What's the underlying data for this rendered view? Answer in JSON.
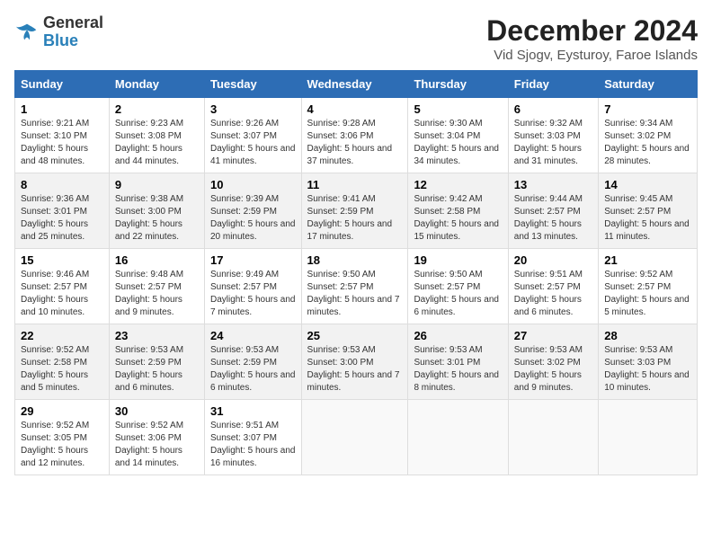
{
  "logo": {
    "general": "General",
    "blue": "Blue"
  },
  "header": {
    "title": "December 2024",
    "subtitle": "Vid Sjogv, Eysturoy, Faroe Islands"
  },
  "days_of_week": [
    "Sunday",
    "Monday",
    "Tuesday",
    "Wednesday",
    "Thursday",
    "Friday",
    "Saturday"
  ],
  "weeks": [
    [
      {
        "day": "1",
        "sunrise": "Sunrise: 9:21 AM",
        "sunset": "Sunset: 3:10 PM",
        "daylight": "Daylight: 5 hours and 48 minutes."
      },
      {
        "day": "2",
        "sunrise": "Sunrise: 9:23 AM",
        "sunset": "Sunset: 3:08 PM",
        "daylight": "Daylight: 5 hours and 44 minutes."
      },
      {
        "day": "3",
        "sunrise": "Sunrise: 9:26 AM",
        "sunset": "Sunset: 3:07 PM",
        "daylight": "Daylight: 5 hours and 41 minutes."
      },
      {
        "day": "4",
        "sunrise": "Sunrise: 9:28 AM",
        "sunset": "Sunset: 3:06 PM",
        "daylight": "Daylight: 5 hours and 37 minutes."
      },
      {
        "day": "5",
        "sunrise": "Sunrise: 9:30 AM",
        "sunset": "Sunset: 3:04 PM",
        "daylight": "Daylight: 5 hours and 34 minutes."
      },
      {
        "day": "6",
        "sunrise": "Sunrise: 9:32 AM",
        "sunset": "Sunset: 3:03 PM",
        "daylight": "Daylight: 5 hours and 31 minutes."
      },
      {
        "day": "7",
        "sunrise": "Sunrise: 9:34 AM",
        "sunset": "Sunset: 3:02 PM",
        "daylight": "Daylight: 5 hours and 28 minutes."
      }
    ],
    [
      {
        "day": "8",
        "sunrise": "Sunrise: 9:36 AM",
        "sunset": "Sunset: 3:01 PM",
        "daylight": "Daylight: 5 hours and 25 minutes."
      },
      {
        "day": "9",
        "sunrise": "Sunrise: 9:38 AM",
        "sunset": "Sunset: 3:00 PM",
        "daylight": "Daylight: 5 hours and 22 minutes."
      },
      {
        "day": "10",
        "sunrise": "Sunrise: 9:39 AM",
        "sunset": "Sunset: 2:59 PM",
        "daylight": "Daylight: 5 hours and 20 minutes."
      },
      {
        "day": "11",
        "sunrise": "Sunrise: 9:41 AM",
        "sunset": "Sunset: 2:59 PM",
        "daylight": "Daylight: 5 hours and 17 minutes."
      },
      {
        "day": "12",
        "sunrise": "Sunrise: 9:42 AM",
        "sunset": "Sunset: 2:58 PM",
        "daylight": "Daylight: 5 hours and 15 minutes."
      },
      {
        "day": "13",
        "sunrise": "Sunrise: 9:44 AM",
        "sunset": "Sunset: 2:57 PM",
        "daylight": "Daylight: 5 hours and 13 minutes."
      },
      {
        "day": "14",
        "sunrise": "Sunrise: 9:45 AM",
        "sunset": "Sunset: 2:57 PM",
        "daylight": "Daylight: 5 hours and 11 minutes."
      }
    ],
    [
      {
        "day": "15",
        "sunrise": "Sunrise: 9:46 AM",
        "sunset": "Sunset: 2:57 PM",
        "daylight": "Daylight: 5 hours and 10 minutes."
      },
      {
        "day": "16",
        "sunrise": "Sunrise: 9:48 AM",
        "sunset": "Sunset: 2:57 PM",
        "daylight": "Daylight: 5 hours and 9 minutes."
      },
      {
        "day": "17",
        "sunrise": "Sunrise: 9:49 AM",
        "sunset": "Sunset: 2:57 PM",
        "daylight": "Daylight: 5 hours and 7 minutes."
      },
      {
        "day": "18",
        "sunrise": "Sunrise: 9:50 AM",
        "sunset": "Sunset: 2:57 PM",
        "daylight": "Daylight: 5 hours and 7 minutes."
      },
      {
        "day": "19",
        "sunrise": "Sunrise: 9:50 AM",
        "sunset": "Sunset: 2:57 PM",
        "daylight": "Daylight: 5 hours and 6 minutes."
      },
      {
        "day": "20",
        "sunrise": "Sunrise: 9:51 AM",
        "sunset": "Sunset: 2:57 PM",
        "daylight": "Daylight: 5 hours and 6 minutes."
      },
      {
        "day": "21",
        "sunrise": "Sunrise: 9:52 AM",
        "sunset": "Sunset: 2:57 PM",
        "daylight": "Daylight: 5 hours and 5 minutes."
      }
    ],
    [
      {
        "day": "22",
        "sunrise": "Sunrise: 9:52 AM",
        "sunset": "Sunset: 2:58 PM",
        "daylight": "Daylight: 5 hours and 5 minutes."
      },
      {
        "day": "23",
        "sunrise": "Sunrise: 9:53 AM",
        "sunset": "Sunset: 2:59 PM",
        "daylight": "Daylight: 5 hours and 6 minutes."
      },
      {
        "day": "24",
        "sunrise": "Sunrise: 9:53 AM",
        "sunset": "Sunset: 2:59 PM",
        "daylight": "Daylight: 5 hours and 6 minutes."
      },
      {
        "day": "25",
        "sunrise": "Sunrise: 9:53 AM",
        "sunset": "Sunset: 3:00 PM",
        "daylight": "Daylight: 5 hours and 7 minutes."
      },
      {
        "day": "26",
        "sunrise": "Sunrise: 9:53 AM",
        "sunset": "Sunset: 3:01 PM",
        "daylight": "Daylight: 5 hours and 8 minutes."
      },
      {
        "day": "27",
        "sunrise": "Sunrise: 9:53 AM",
        "sunset": "Sunset: 3:02 PM",
        "daylight": "Daylight: 5 hours and 9 minutes."
      },
      {
        "day": "28",
        "sunrise": "Sunrise: 9:53 AM",
        "sunset": "Sunset: 3:03 PM",
        "daylight": "Daylight: 5 hours and 10 minutes."
      }
    ],
    [
      {
        "day": "29",
        "sunrise": "Sunrise: 9:52 AM",
        "sunset": "Sunset: 3:05 PM",
        "daylight": "Daylight: 5 hours and 12 minutes."
      },
      {
        "day": "30",
        "sunrise": "Sunrise: 9:52 AM",
        "sunset": "Sunset: 3:06 PM",
        "daylight": "Daylight: 5 hours and 14 minutes."
      },
      {
        "day": "31",
        "sunrise": "Sunrise: 9:51 AM",
        "sunset": "Sunset: 3:07 PM",
        "daylight": "Daylight: 5 hours and 16 minutes."
      },
      null,
      null,
      null,
      null
    ]
  ]
}
